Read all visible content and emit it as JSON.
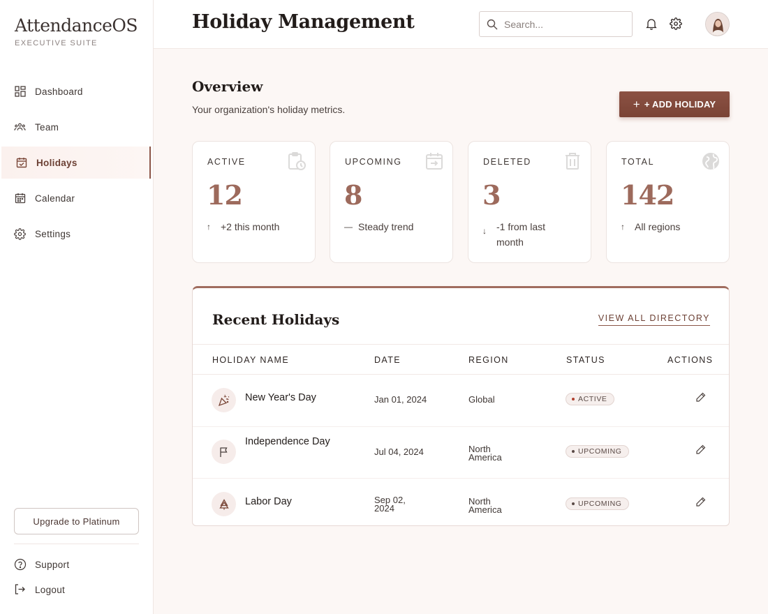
{
  "brand": {
    "name": "AttendanceOS",
    "subtitle": "EXECUTIVE SUITE"
  },
  "sidebar": {
    "items": [
      {
        "label": "Dashboard",
        "icon": "grid-icon"
      },
      {
        "label": "Team",
        "icon": "team-icon"
      },
      {
        "label": "Holidays",
        "icon": "calendar-check-icon",
        "active": true
      },
      {
        "label": "Calendar",
        "icon": "calendar-icon"
      },
      {
        "label": "Settings",
        "icon": "gear-icon"
      }
    ],
    "upgrade_label": "Upgrade to Platinum",
    "support_label": "Support",
    "logout_label": "Logout"
  },
  "header": {
    "title": "Holiday Management",
    "search_placeholder": "Search..."
  },
  "overview": {
    "title": "Overview",
    "subtitle": "Your organization's holiday metrics.",
    "add_label": "+ ADD HOLIDAY"
  },
  "stats": [
    {
      "label": "ACTIVE",
      "value": "12",
      "trend": "+2 this month",
      "arrow": "↑",
      "icon": "clipboard-clock-icon"
    },
    {
      "label": "UPCOMING",
      "value": "8",
      "trend": "Steady trend",
      "arrow": "—",
      "icon": "calendar-arrow-icon"
    },
    {
      "label": "DELETED",
      "value": "3",
      "trend": "-1 from last month",
      "arrow": "↓",
      "icon": "trash-icon"
    },
    {
      "label": "TOTAL",
      "value": "142",
      "trend": "All regions",
      "arrow": "↑",
      "icon": "globe-icon"
    }
  ],
  "recent": {
    "title": "Recent Holidays",
    "view_all": "VIEW ALL DIRECTORY",
    "columns": [
      "HOLIDAY NAME",
      "DATE",
      "REGION",
      "STATUS",
      "ACTIONS"
    ],
    "rows": [
      {
        "name": "New Year's Day",
        "date": "Jan 01, 2024",
        "region": "Global",
        "status": "ACTIVE",
        "icon": "party-popper-icon"
      },
      {
        "name": "Independence Day",
        "date": "Jul 04, 2024",
        "region": "North America",
        "status": "UPCOMING",
        "icon": "flag-icon"
      },
      {
        "name": "Labor Day",
        "date": "Sep 02, 2024",
        "region": "North America",
        "status": "UPCOMING",
        "icon": "tree-icon"
      }
    ]
  },
  "colors": {
    "accent": "#8b5547",
    "active_dot": "#b0402f",
    "upcoming_dot": "#5a4a46"
  }
}
